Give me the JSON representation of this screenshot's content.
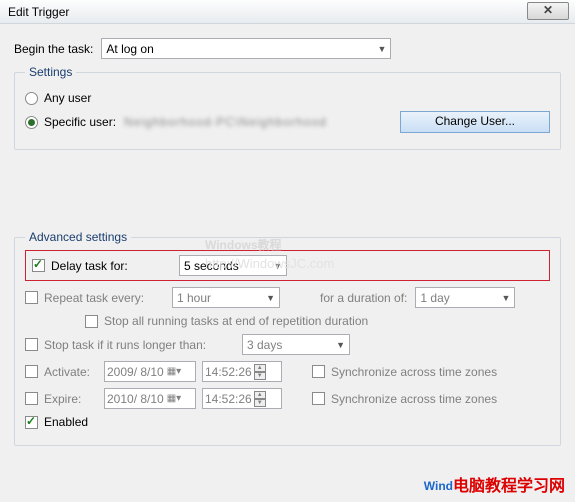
{
  "window": {
    "title": "Edit Trigger",
    "close_glyph": "✕"
  },
  "begin": {
    "label": "Begin the task:",
    "value": "At log on"
  },
  "settings": {
    "legend": "Settings",
    "any_user": "Any user",
    "specific_user": "Specific user:",
    "specific_value": "Neighborhood-PC\\Neighborhood",
    "change_user": "Change User..."
  },
  "advanced": {
    "legend": "Advanced settings",
    "delay_label": "Delay task for:",
    "delay_value": "5 seconds",
    "repeat_label": "Repeat task every:",
    "repeat_value": "1 hour",
    "duration_label": "for a duration of:",
    "duration_value": "1 day",
    "stop_repetition": "Stop all running tasks at end of repetition duration",
    "stop_longer_label": "Stop task if it runs longer than:",
    "stop_longer_value": "3 days",
    "activate_label": "Activate:",
    "activate_date": "2009/ 8/10",
    "activate_time": "14:52:26",
    "expire_label": "Expire:",
    "expire_date": "2010/ 8/10",
    "expire_time": "14:52:26",
    "sync_tz": "Synchronize across time zones",
    "enabled_label": "Enabled"
  },
  "watermark": {
    "main": "Windows教程",
    "sub": "http://WindowsJC.com"
  },
  "footer": {
    "blue": "Wind",
    "red": "电脑教程学习网"
  }
}
